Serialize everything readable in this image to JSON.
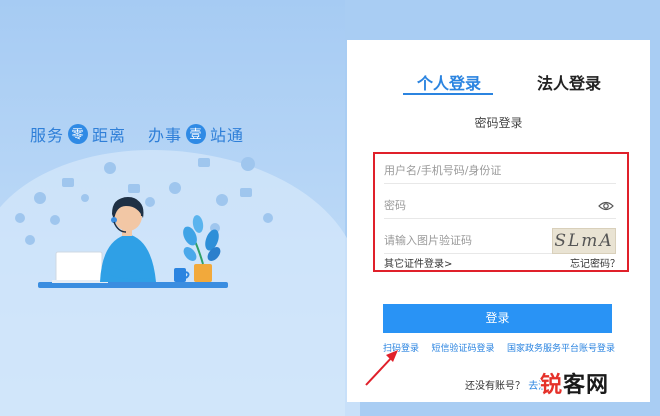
{
  "slogan": {
    "part1": "服务",
    "badge1": "零",
    "part2": "距离",
    "part3": "办事",
    "badge2": "壹",
    "part4": "站通"
  },
  "tabs": {
    "personal": "个人登录",
    "corporate": "法人登录"
  },
  "subtitle": "密码登录",
  "form": {
    "username_placeholder": "用户名/手机号码/身份证",
    "password_placeholder": "密码",
    "captcha_placeholder": "请输入图片验证码",
    "captcha_text": "SLmA",
    "other_id_login": "其它证件登录>",
    "forgot_password": "忘记密码？"
  },
  "login_button": "登录",
  "alt_logins": {
    "scan": "扫码登录",
    "sms": "短信验证码登录",
    "gov_platform": "国家政务服务平台账号登录"
  },
  "register": {
    "prompt": "还没有账号？",
    "link": "去注"
  },
  "watermark": {
    "part1": "锐",
    "part2": "客网"
  },
  "colors": {
    "accent": "#2b84e0",
    "button": "#2993f5",
    "highlight_border": "#e0202a",
    "background": "#a9cdf3"
  }
}
